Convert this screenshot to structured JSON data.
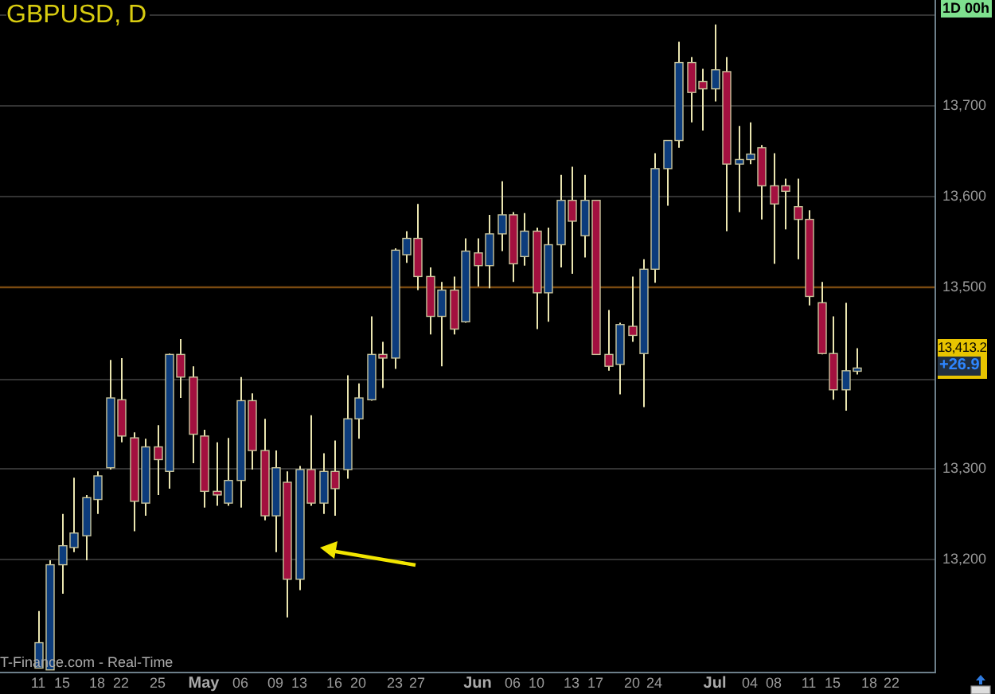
{
  "chart": {
    "title": "GBPUSD, D",
    "timeframe_badge": "1D 00h",
    "source_label": "T-Finance.com - Real-Time",
    "chart_data": {
      "type": "candlestick",
      "categories": [
        "11",
        null,
        "15",
        null,
        null,
        "18",
        null,
        "22",
        null,
        null,
        "25",
        null,
        null,
        null,
        "May",
        null,
        null,
        "06",
        null,
        null,
        "09",
        null,
        "13",
        null,
        null,
        "16",
        null,
        "20",
        null,
        null,
        "23",
        null,
        "27",
        null,
        null,
        null,
        null,
        "Jun",
        null,
        null,
        "06",
        null,
        "10",
        null,
        null,
        "13",
        null,
        "17",
        null,
        null,
        "20",
        null,
        "24",
        null,
        null,
        null,
        null,
        "Jul",
        null,
        null,
        "04",
        null,
        "08",
        null,
        null,
        "11",
        null,
        "15",
        null,
        null,
        "18",
        null,
        "22"
      ],
      "ohlc": [
        [
          13079,
          13142,
          13079,
          13107
        ],
        [
          13077,
          13198,
          13077,
          13193
        ],
        [
          13193,
          13249,
          13161,
          13214
        ],
        [
          13212,
          13289,
          13207,
          13228
        ],
        [
          13225,
          13270,
          13198,
          13267
        ],
        [
          13265,
          13296,
          13249,
          13291
        ],
        [
          13300,
          13419,
          13298,
          13377
        ],
        [
          13375,
          13421,
          13328,
          13335
        ],
        [
          13333,
          13339,
          13230,
          13263
        ],
        [
          13261,
          13332,
          13247,
          13323
        ],
        [
          13323,
          13347,
          13270,
          13309
        ],
        [
          13296,
          13426,
          13277,
          13425
        ],
        [
          13425,
          13442,
          13377,
          13400
        ],
        [
          13400,
          13412,
          13305,
          13337
        ],
        [
          13335,
          13342,
          13256,
          13274
        ],
        [
          13274,
          13328,
          13258,
          13270
        ],
        [
          13261,
          13333,
          13258,
          13286
        ],
        [
          13286,
          13400,
          13256,
          13374
        ],
        [
          13374,
          13382,
          13298,
          13319
        ],
        [
          13319,
          13354,
          13242,
          13247
        ],
        [
          13247,
          13319,
          13207,
          13300
        ],
        [
          13284,
          13296,
          13135,
          13177
        ],
        [
          13177,
          13302,
          13165,
          13298
        ],
        [
          13298,
          13358,
          13258,
          13261
        ],
        [
          13261,
          13316,
          13249,
          13296
        ],
        [
          13296,
          13330,
          13247,
          13277
        ],
        [
          13298,
          13402,
          13288,
          13354
        ],
        [
          13354,
          13393,
          13332,
          13377
        ],
        [
          13375,
          13467,
          13374,
          13425
        ],
        [
          13425,
          13439,
          13388,
          13421
        ],
        [
          13421,
          13542,
          13409,
          13540
        ],
        [
          13535,
          13561,
          13526,
          13553
        ],
        [
          13553,
          13591,
          13496,
          13511
        ],
        [
          13511,
          13521,
          13447,
          13467
        ],
        [
          13467,
          13505,
          13412,
          13496
        ],
        [
          13496,
          13511,
          13447,
          13453
        ],
        [
          13461,
          13553,
          13460,
          13539
        ],
        [
          13537,
          13553,
          13500,
          13523
        ],
        [
          13523,
          13579,
          13498,
          13558
        ],
        [
          13558,
          13616,
          13539,
          13579
        ],
        [
          13579,
          13582,
          13505,
          13525
        ],
        [
          13533,
          13581,
          13523,
          13561
        ],
        [
          13561,
          13565,
          13453,
          13493
        ],
        [
          13493,
          13565,
          13461,
          13546
        ],
        [
          13546,
          13623,
          13521,
          13595
        ],
        [
          13595,
          13632,
          13514,
          13572
        ],
        [
          13556,
          13623,
          13532,
          13595
        ],
        [
          13595,
          13595,
          13425,
          13425
        ],
        [
          13425,
          13474,
          13407,
          13412
        ],
        [
          13414,
          13460,
          13381,
          13458
        ],
        [
          13456,
          13511,
          13439,
          13446
        ],
        [
          13426,
          13530,
          13367,
          13519
        ],
        [
          13519,
          13647,
          13504,
          13630
        ],
        [
          13630,
          13661,
          13589,
          13661
        ],
        [
          13661,
          13770,
          13653,
          13747
        ],
        [
          13747,
          13753,
          13681,
          13714
        ],
        [
          13726,
          13740,
          13672,
          13718
        ],
        [
          13718,
          13789,
          13704,
          13739
        ],
        [
          13737,
          13753,
          13561,
          13635
        ],
        [
          13635,
          13677,
          13582,
          13640
        ],
        [
          13640,
          13681,
          13635,
          13646
        ],
        [
          13653,
          13656,
          13574,
          13611
        ],
        [
          13611,
          13647,
          13525,
          13591
        ],
        [
          13611,
          13619,
          13563,
          13605
        ],
        [
          13588,
          13619,
          13530,
          13574
        ],
        [
          13574,
          13584,
          13479,
          13489
        ],
        [
          13482,
          13505,
          13425,
          13426
        ],
        [
          13426,
          13467,
          13375,
          13386
        ],
        [
          13386,
          13482,
          13363,
          13407
        ],
        [
          13407,
          13432,
          13403,
          13410
        ],
        null,
        null,
        null
      ],
      "grid": true,
      "ylim": [
        13075,
        13816
      ],
      "yticks": [
        {
          "value": 13700,
          "label": "13,700"
        },
        {
          "value": 13600,
          "label": "13,600"
        },
        {
          "value": 13500,
          "label": "13,500"
        },
        {
          "value": 13300,
          "label": "13,300"
        },
        {
          "value": 13200,
          "label": "13,200"
        }
      ],
      "ref_lines": [
        {
          "axis": "y",
          "value": 13500
        }
      ]
    }
  },
  "price_label": {
    "price": "13,413.2",
    "change": "+26.9"
  }
}
